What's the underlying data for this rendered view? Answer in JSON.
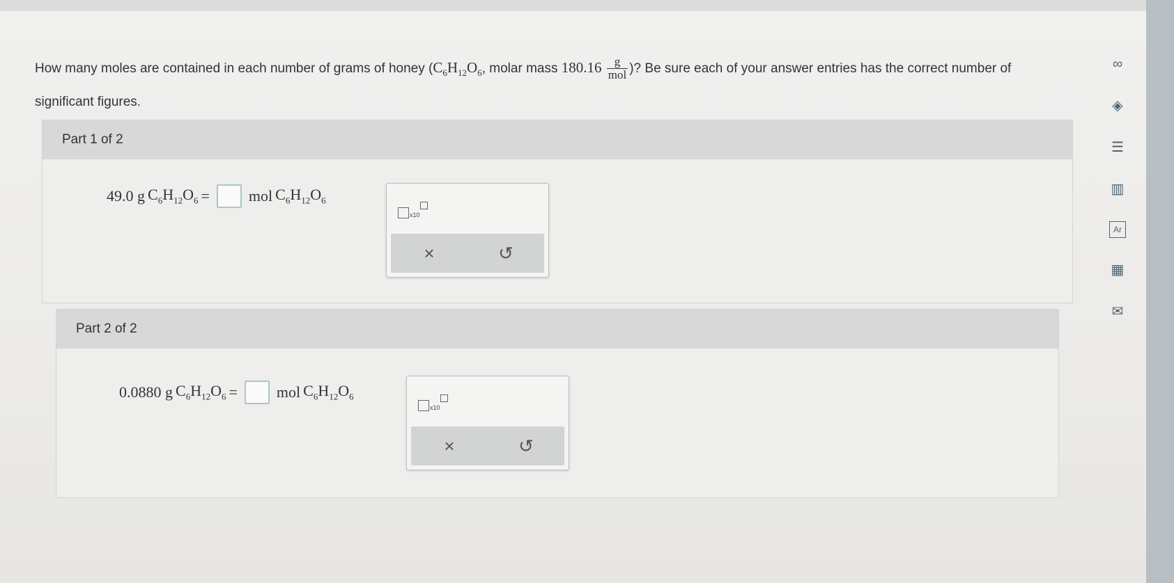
{
  "question": {
    "lead": "How many moles are contained in each number of grams of honey (",
    "formula_c": "C",
    "formula_c_sub": "6",
    "formula_h": "H",
    "formula_h_sub": "12",
    "formula_o": "O",
    "formula_o_sub": "6",
    "mid": ", molar mass",
    "molar_mass": "180.16",
    "unit_num": "g",
    "unit_den": "mol",
    "tail": ")? Be sure each of your answer entries has the correct number of significant figures."
  },
  "parts": [
    {
      "header": "Part 1 of 2",
      "given": "49.0 g",
      "result_unit": "mol",
      "sci_label": "x10"
    },
    {
      "header": "Part 2 of 2",
      "given": "0.0880 g",
      "result_unit": "mol",
      "sci_label": "x10"
    }
  ],
  "formula": {
    "c": "C",
    "c_sub": "6",
    "h": "H",
    "h_sub": "12",
    "o": "O",
    "o_sub": "6",
    "equals": "="
  },
  "tool": {
    "clear": "×",
    "undo": "↺"
  },
  "sidebar": {
    "icons": [
      "infinity-icon",
      "tag-icon",
      "notes-icon",
      "chart-icon",
      "periodic-table-icon",
      "calculator-icon",
      "mail-icon"
    ],
    "glyphs": [
      "∞",
      "◈",
      "☰",
      "▥",
      "Ar",
      "▦",
      "✉"
    ]
  },
  "colors": {
    "answer_border": "#a9c6cc",
    "header_bg": "#d7d8d7",
    "icon": "#4e6472"
  }
}
